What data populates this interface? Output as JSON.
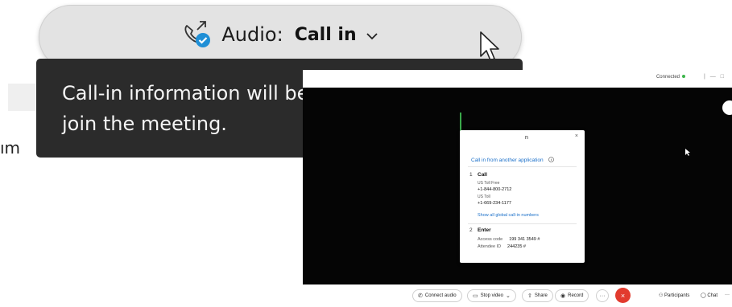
{
  "background": {
    "text_fragment": "ım"
  },
  "audio_button": {
    "label": "Audio:",
    "value": "Call in",
    "icon": "phone-connected-icon",
    "chevron_icon": "chevron-down-icon",
    "accent_color": "#1f8fd6"
  },
  "tooltip": {
    "text": "Call-in information will be available after you join the meeting."
  },
  "meeting": {
    "status": "Connected",
    "dialog": {
      "title": "n",
      "close": "×",
      "link": "Call in from another application",
      "step1_number": "1",
      "step1_title": "Call",
      "toll_free_label": "US Toll Free",
      "toll_free_number": "+1-844-800-2712",
      "toll_label": "US Toll",
      "toll_number": "+1-669-234-1177",
      "show_all_link": "Show all global call-in numbers",
      "step2_number": "2",
      "step2_title": "Enter",
      "access_code_label": "Access code",
      "access_code_value": "199 341 3549 #",
      "attendee_id_label": "Attendee ID",
      "attendee_id_value": "244235 #"
    },
    "controls": {
      "connect_audio": "Connect audio",
      "stop_video": "Stop video",
      "share": "Share",
      "record": "Record",
      "more": "···",
      "end": "×",
      "participants": "Participants",
      "chat": "Chat",
      "overflow": "···"
    }
  }
}
